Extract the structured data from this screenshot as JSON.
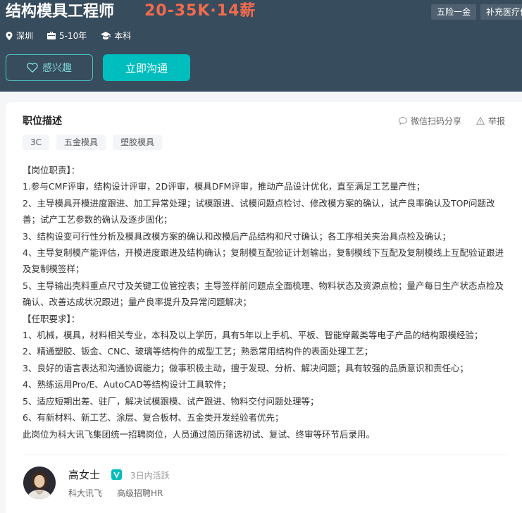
{
  "job": {
    "title": "结构模具工程师",
    "salary": "20-35K·14薪",
    "benefits": [
      "五险一金",
      "补充医疗保"
    ],
    "location": "深圳",
    "experience": "5-10年",
    "education": "本科"
  },
  "actions": {
    "interest_label": "感兴趣",
    "chat_label": "立即沟通"
  },
  "description": {
    "section_title": "职位描述",
    "share_label": "微信扫码分享",
    "report_label": "举报",
    "skills": [
      "3C",
      "五金模具",
      "塑胶模具"
    ],
    "lines": [
      "【岗位职责】：",
      "1.参与CMF评审，结构设计评审，2D评审，模具DFM评审，推动产品设计优化，直至满足工艺量产性；",
      "2、主导模具开模进度跟进、加工异常处理；试模跟进、试模问题点检讨、修改模方案的确认，试产良率确认及TOP问题改善；试产工艺参数的确认及逐步固化；",
      "3、结构设变可行性分析及模具改模方案的确认和改模后产品结构和尺寸确认；各工序相关夹治具点检及确认；",
      "4、主导复制模产能评估，开模进度跟进及结构确认；复制模互配验证计划输出，复制模线下互配及复制模线上互配验证跟进及复制模签样；",
      "5、主导输出壳料重点尺寸及关键工位管控表；主导签样前问题点全面梳理、物料状态及资源点检；量产每日生产状态点检及确认、改善达成状况跟进；量产良率提升及异常问题解决；",
      "【任职要求】：",
      "1、机械，模具，材料相关专业，本科及以上学历，具有5年以上手机、平板、智能穿戴类等电子产品的结构跟模经验；",
      "2、精通塑胶、钣金、CNC、玻璃等结构件的成型工艺；熟悉常用结构件的表面处理工艺；",
      "3、良好的语言表达和沟通协调能力；做事积极主动，擅于发现、分析、解决问题；具有较强的品质意识和责任心；",
      "4、熟练运用Pro/E、AutoCAD等结构设计工具软件；",
      "5、适应短期出差、驻厂，解决试模跟模、试产跟进、物料交付问题处理等；",
      "6、有新材料、新工艺、涂层、复合板材、五金类开发经验者优先；",
      "此岗位为科大讯飞集团统一招聘岗位，人员通过简历筛选初试、复试、终审等环节后录用。"
    ]
  },
  "recruiter": {
    "name": "高女士",
    "active_status": "3日内活跃",
    "company": "科大讯飞",
    "role": "高级招聘HR"
  },
  "colors": {
    "header_bg": "#374c5d",
    "salary": "#f26b4e",
    "accent": "#00bebd"
  }
}
